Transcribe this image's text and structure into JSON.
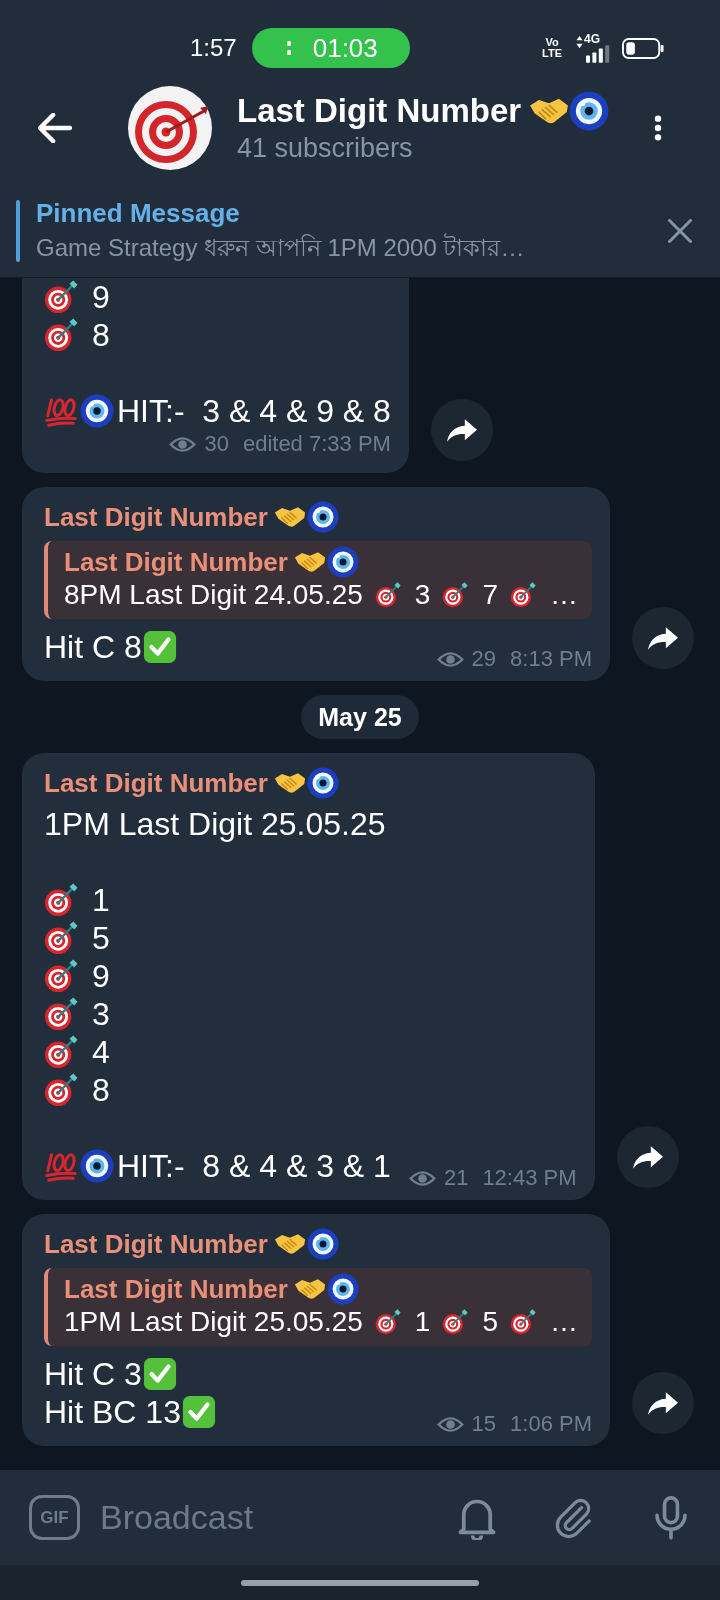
{
  "status_bar": {
    "time": "1:57",
    "call_timer": "01:03",
    "volte": [
      "Vo",
      "LTE"
    ],
    "network": "4G"
  },
  "header": {
    "title": [
      {
        "kind": "text",
        "text": "Last Digit Number"
      },
      {
        "kind": "handshake"
      },
      {
        "kind": "nazar"
      }
    ],
    "subtitle": "41 subscribers"
  },
  "pinned": {
    "label": "Pinned Message",
    "text": "Game Strategy ধরুন আপনি 1PM 2000 টাকার…"
  },
  "messages": [
    {
      "kind": "post",
      "cut_off_top": true,
      "paragraphs": [
        [
          [
            {
              "kind": "target"
            },
            {
              "kind": "text",
              "text": "9"
            }
          ],
          [
            {
              "kind": "target"
            },
            {
              "kind": "text",
              "text": "8"
            }
          ]
        ],
        [
          [
            {
              "kind": "hundred"
            },
            {
              "kind": "nazar"
            },
            {
              "kind": "text",
              "text": "HIT:-  3 & 4 & 9 & 8"
            }
          ]
        ]
      ],
      "views": "30",
      "time": "edited 7:33 PM"
    },
    {
      "kind": "post",
      "cut_off_top": false,
      "sender": [
        {
          "kind": "text",
          "text": "Last Digit Number"
        },
        {
          "kind": "handshake"
        },
        {
          "kind": "nazar"
        }
      ],
      "quote": {
        "sender": [
          {
            "kind": "text",
            "text": "Last Digit Number"
          },
          {
            "kind": "handshake"
          },
          {
            "kind": "nazar"
          }
        ],
        "text": [
          {
            "kind": "text",
            "text": "8PM Last Digit 24.05.25"
          },
          {
            "kind": "target"
          },
          {
            "kind": "text",
            "text": "3"
          },
          {
            "kind": "target"
          },
          {
            "kind": "text",
            "text": "7"
          },
          {
            "kind": "target"
          },
          {
            "kind": "text",
            "text": "…"
          }
        ]
      },
      "paragraphs": [
        [
          [
            {
              "kind": "text",
              "text": "Hit C 8"
            },
            {
              "kind": "check"
            }
          ]
        ]
      ],
      "views": "29",
      "time": "8:13 PM"
    },
    {
      "kind": "date",
      "text": "May 25"
    },
    {
      "kind": "post",
      "cut_off_top": false,
      "sender": [
        {
          "kind": "text",
          "text": "Last Digit Number"
        },
        {
          "kind": "handshake"
        },
        {
          "kind": "nazar"
        }
      ],
      "paragraphs": [
        [
          [
            {
              "kind": "text",
              "text": "1PM Last Digit 25.05.25"
            }
          ]
        ],
        [
          [
            {
              "kind": "target"
            },
            {
              "kind": "text",
              "text": "1"
            }
          ],
          [
            {
              "kind": "target"
            },
            {
              "kind": "text",
              "text": "5"
            }
          ],
          [
            {
              "kind": "target"
            },
            {
              "kind": "text",
              "text": "9"
            }
          ],
          [
            {
              "kind": "target"
            },
            {
              "kind": "text",
              "text": "3"
            }
          ],
          [
            {
              "kind": "target"
            },
            {
              "kind": "text",
              "text": "4"
            }
          ],
          [
            {
              "kind": "target"
            },
            {
              "kind": "text",
              "text": "8"
            }
          ]
        ],
        [
          [
            {
              "kind": "hundred"
            },
            {
              "kind": "nazar"
            },
            {
              "kind": "text",
              "text": "HIT:-  8 & 4 & 3 & 1"
            }
          ]
        ]
      ],
      "views": "21",
      "time": "12:43 PM"
    },
    {
      "kind": "post",
      "cut_off_top": false,
      "sender": [
        {
          "kind": "text",
          "text": "Last Digit Number"
        },
        {
          "kind": "handshake"
        },
        {
          "kind": "nazar"
        }
      ],
      "quote": {
        "sender": [
          {
            "kind": "text",
            "text": "Last Digit Number"
          },
          {
            "kind": "handshake"
          },
          {
            "kind": "nazar"
          }
        ],
        "text": [
          {
            "kind": "text",
            "text": "1PM Last Digit 25.05.25"
          },
          {
            "kind": "target"
          },
          {
            "kind": "text",
            "text": "1"
          },
          {
            "kind": "target"
          },
          {
            "kind": "text",
            "text": "5"
          },
          {
            "kind": "target"
          },
          {
            "kind": "text",
            "text": "…"
          }
        ]
      },
      "paragraphs": [
        [
          [
            {
              "kind": "text",
              "text": "Hit C 3"
            },
            {
              "kind": "check"
            }
          ],
          [
            {
              "kind": "text",
              "text": "Hit BC 13"
            },
            {
              "kind": "check"
            }
          ]
        ]
      ],
      "views": "15",
      "time": "1:06 PM"
    }
  ],
  "composer": {
    "gif": "GIF",
    "placeholder": "Broadcast"
  }
}
